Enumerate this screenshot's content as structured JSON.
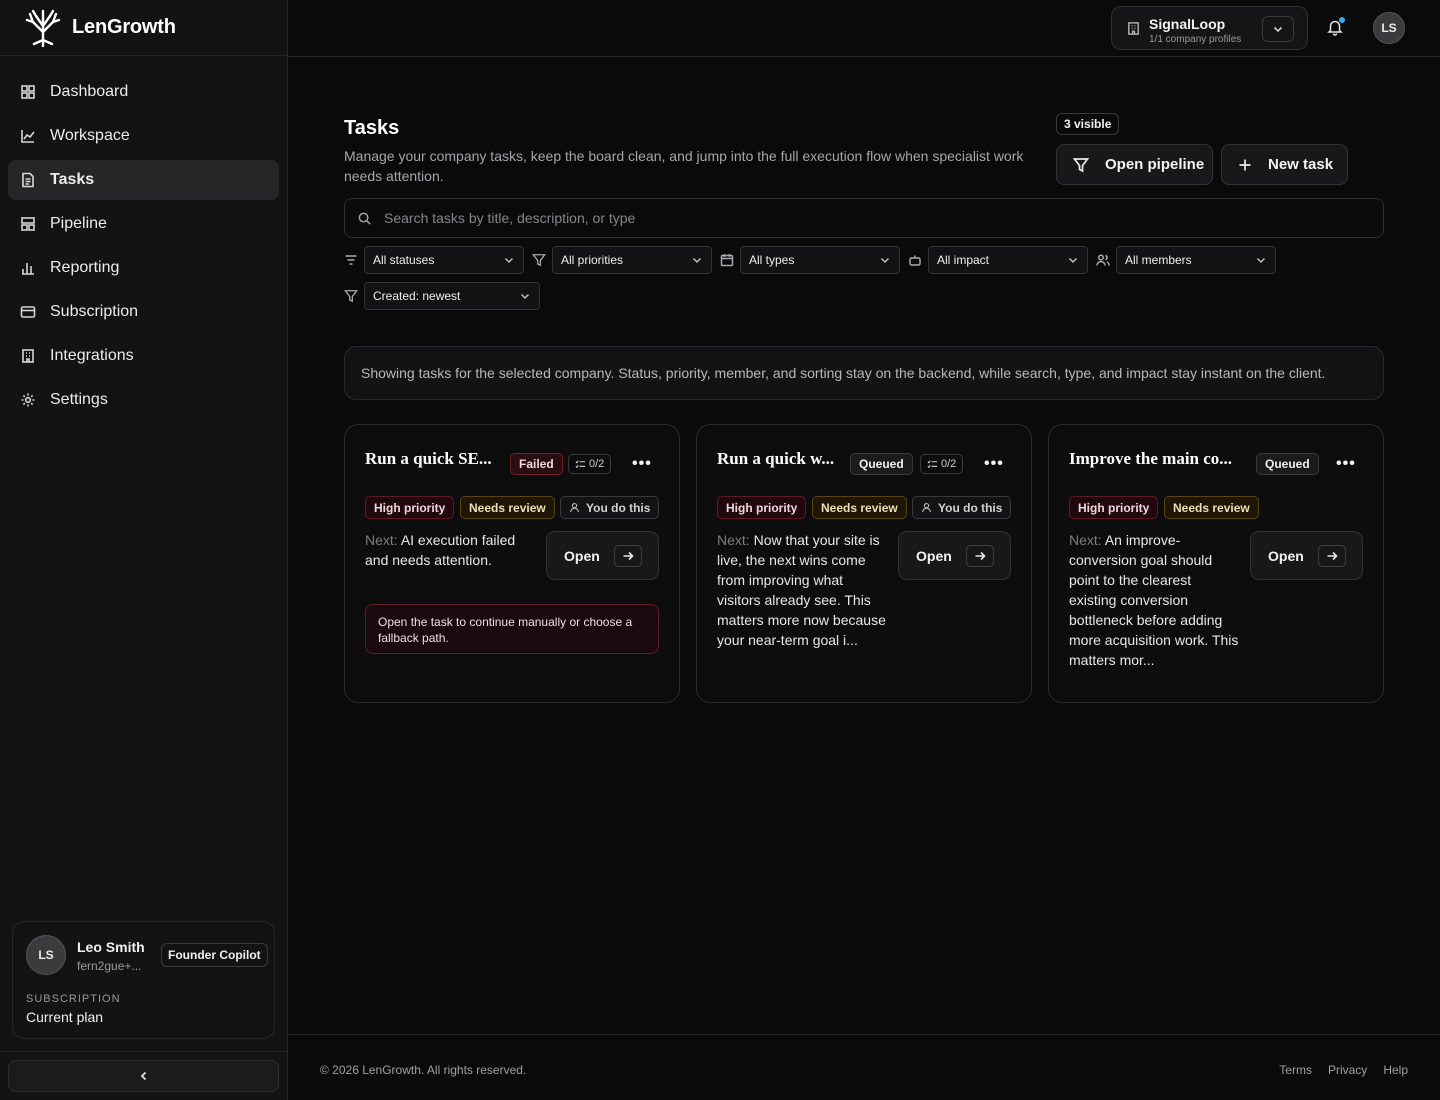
{
  "brand": {
    "name": "LenGrowth"
  },
  "nav": {
    "items": [
      {
        "label": "Dashboard",
        "icon": "dashboard-icon"
      },
      {
        "label": "Workspace",
        "icon": "chart-line-icon"
      },
      {
        "label": "Tasks",
        "icon": "document-icon",
        "active": true
      },
      {
        "label": "Pipeline",
        "icon": "pipeline-icon"
      },
      {
        "label": "Reporting",
        "icon": "bar-chart-icon"
      },
      {
        "label": "Subscription",
        "icon": "credit-card-icon"
      },
      {
        "label": "Integrations",
        "icon": "building-icon"
      },
      {
        "label": "Settings",
        "icon": "gear-icon"
      }
    ]
  },
  "user": {
    "initials": "LS",
    "name": "Leo Smith",
    "email": "fern2gue+...",
    "role_badge": "Founder Copilot",
    "subscription_label": "SUBSCRIPTION",
    "plan": "Current plan"
  },
  "topbar": {
    "company_name": "SignalLoop",
    "company_sub": "1/1 company profiles",
    "avatar_initials": "LS"
  },
  "page": {
    "title": "Tasks",
    "description": "Manage your company tasks, keep the board clean, and jump into the full execution flow when specialist work needs attention.",
    "visible_badge": "3 visible",
    "open_pipeline_label": "Open pipeline",
    "new_task_label": "New task",
    "search_placeholder": "Search tasks by title, description, or type",
    "info_text": "Showing tasks for the selected company. Status, priority, member, and sorting stay on the backend, while search, type, and impact stay instant on the client."
  },
  "filters": {
    "status": "All statuses",
    "priority": "All priorities",
    "type": "All types",
    "impact": "All impact",
    "members": "All members",
    "sort": "Created: newest"
  },
  "cards": [
    {
      "title": "Run a quick SE...",
      "status": "Failed",
      "steps": "0/2",
      "tags": [
        "High priority",
        "Needs review",
        "You do this"
      ],
      "next_label": "Next:",
      "next_text": "AI execution failed and needs attention.",
      "open_label": "Open",
      "warning": "Open the task to continue manually or choose a fallback path."
    },
    {
      "title": "Run a quick w...",
      "status": "Queued",
      "steps": "0/2",
      "tags": [
        "High priority",
        "Needs review",
        "You do this"
      ],
      "next_label": "Next:",
      "next_text": "Now that your site is live, the next wins come from improving what visitors already see. This matters more now because your near-term goal i...",
      "open_label": "Open"
    },
    {
      "title": "Improve the main co...",
      "status": "Queued",
      "tags": [
        "High priority",
        "Needs review"
      ],
      "next_label": "Next:",
      "next_text": "An improve-conversion goal should point to the clearest existing conversion bottleneck before adding more acquisition work. This matters mor...",
      "open_label": "Open"
    }
  ],
  "footer": {
    "copyright": "© 2026 LenGrowth. All rights reserved.",
    "links": [
      "Terms",
      "Privacy",
      "Help"
    ]
  }
}
